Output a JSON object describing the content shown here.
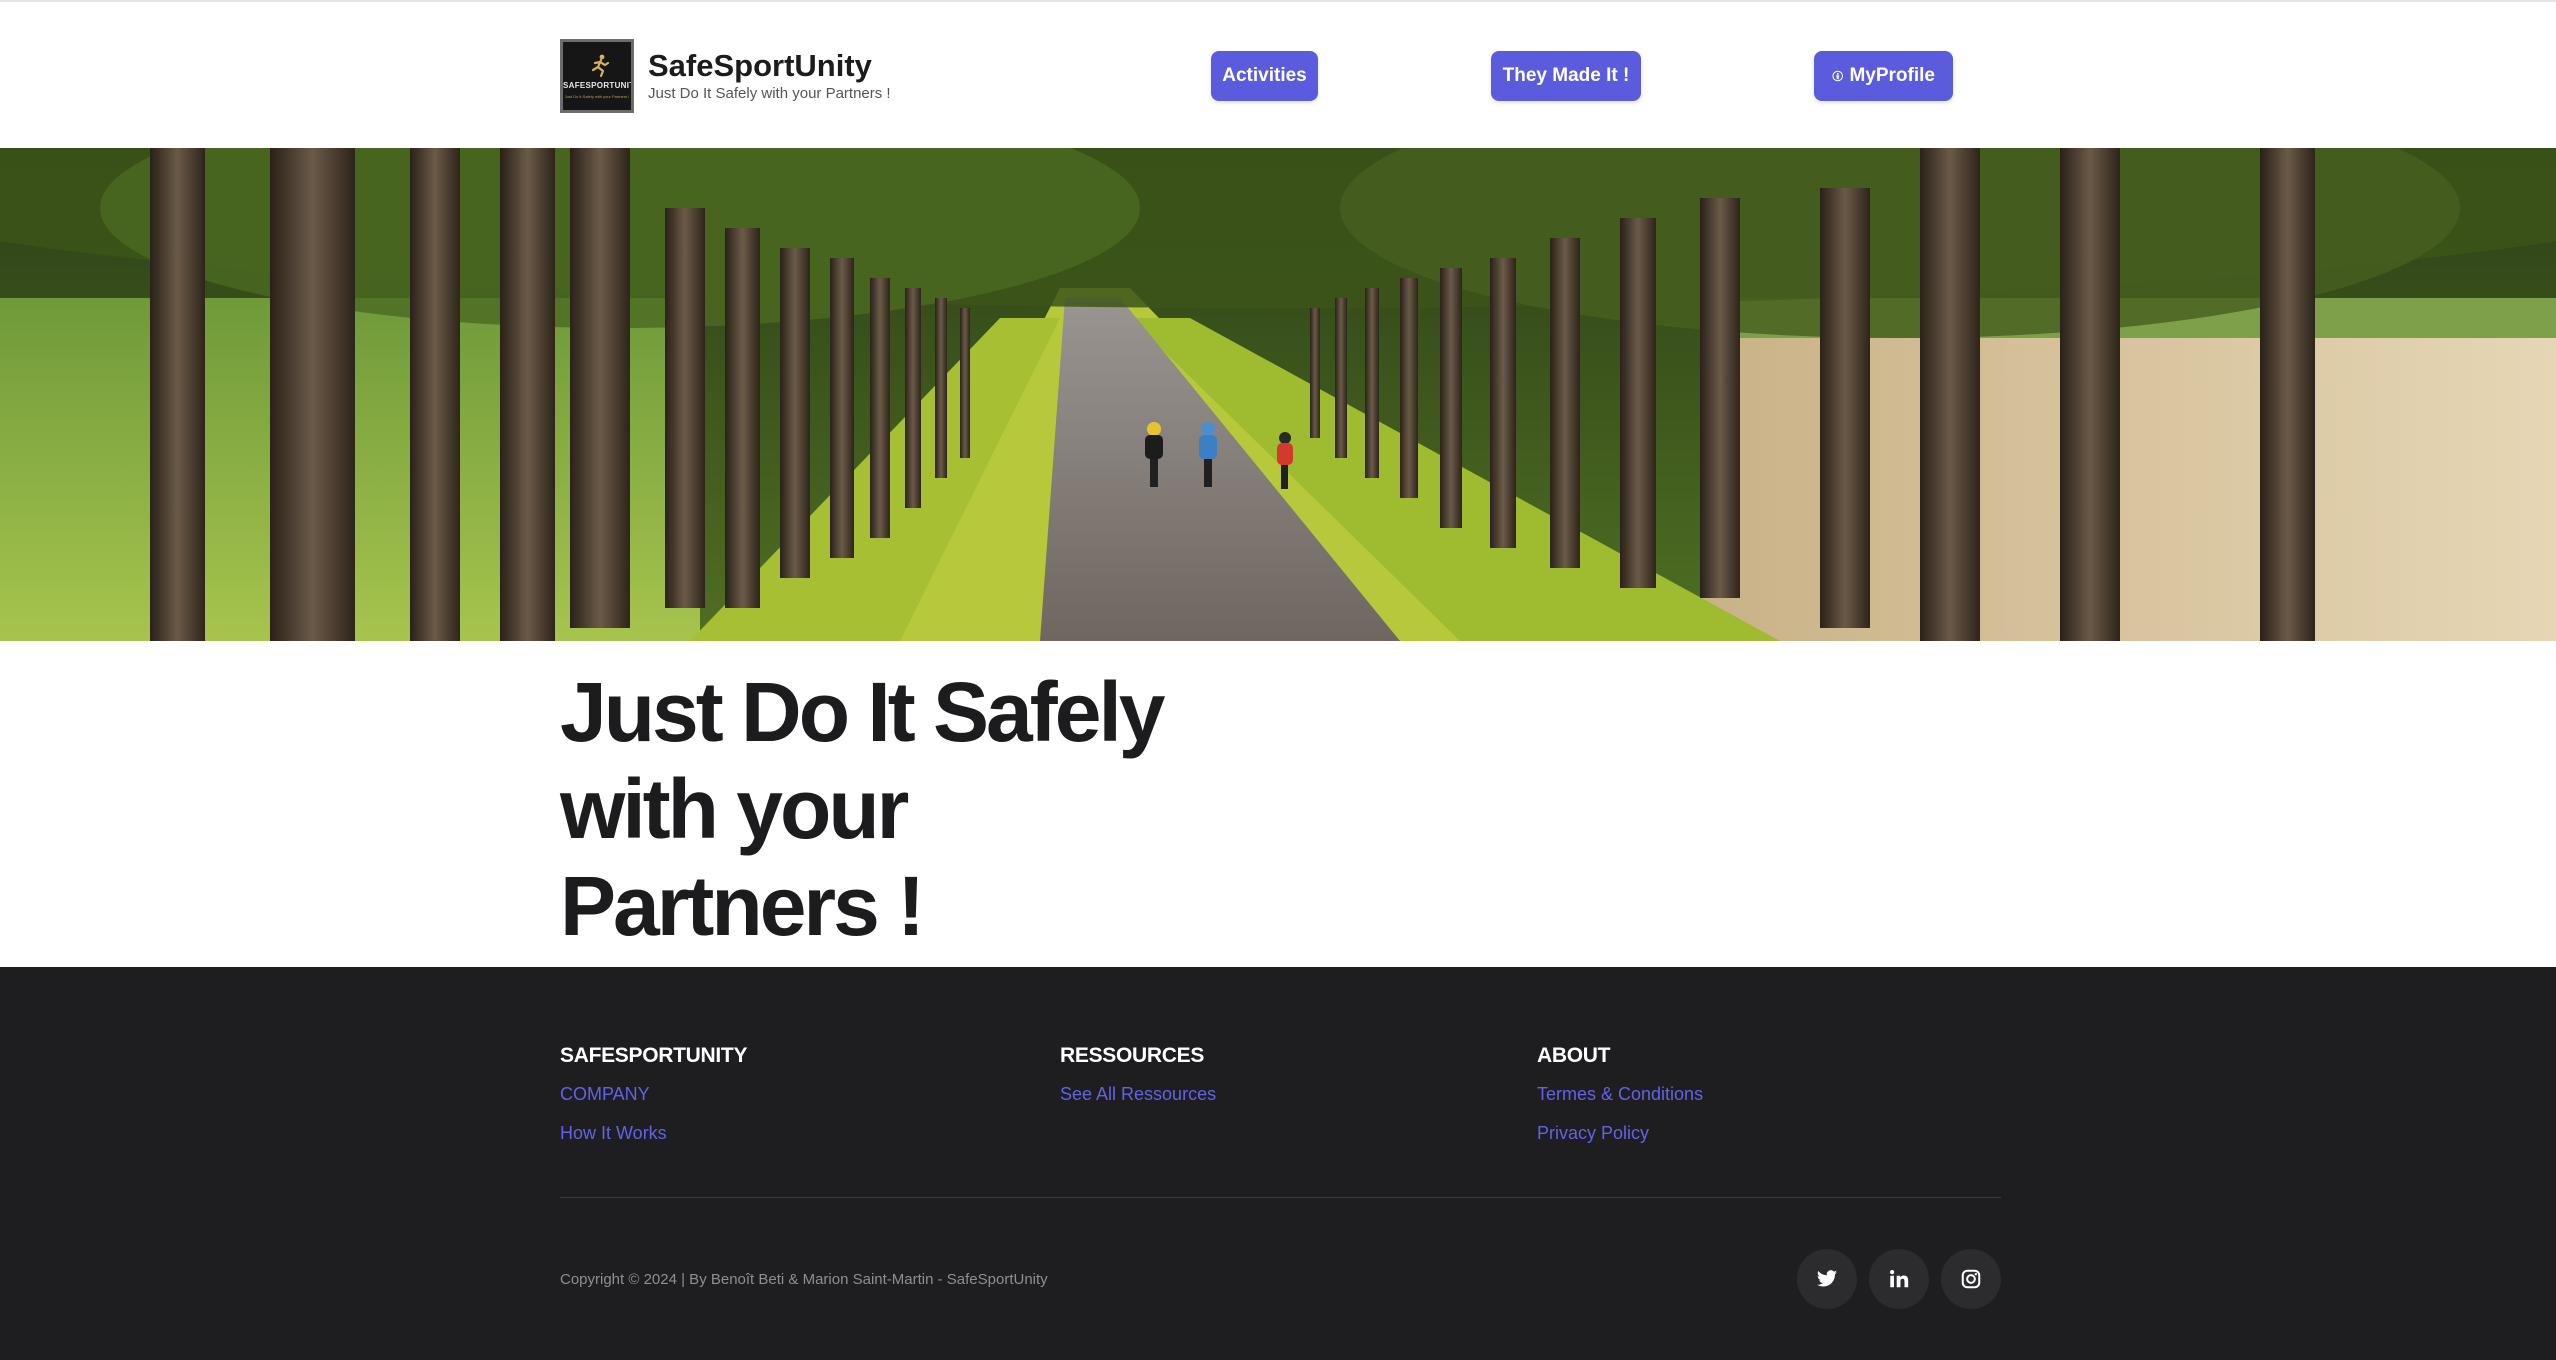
{
  "header": {
    "brand_name": "SafeSportUnity",
    "tagline": "Just Do It Safely with your Partners !",
    "logo_text": "SAFESPORTUNITY",
    "nav": [
      {
        "label": "Activities"
      },
      {
        "label": "They Made It !"
      },
      {
        "label": "MyProfile",
        "icon": "person-icon"
      }
    ]
  },
  "hero": {
    "image": "tree-lined-road-cyclists"
  },
  "main": {
    "headline": "Just Do It Safely with your Partners !"
  },
  "footer": {
    "columns": [
      {
        "title": "SAFESPORTUNITY",
        "links": [
          "COMPANY",
          "How It Works"
        ]
      },
      {
        "title": "RESSOURCES",
        "links": [
          "See All Ressources"
        ]
      },
      {
        "title": "ABOUT",
        "links": [
          "Termes & Conditions",
          "Privacy Policy"
        ]
      }
    ],
    "copyright": "Copyright © 2024 | By Benoît Beti & Marion Saint-Martin - SafeSportUnity",
    "social": [
      "twitter-icon",
      "linkedin-icon",
      "instagram-icon"
    ]
  },
  "colors": {
    "accent": "#5b5bdd",
    "footer_bg": "#1e1e20",
    "link": "#6262e8",
    "text": "#1c1c1e"
  }
}
